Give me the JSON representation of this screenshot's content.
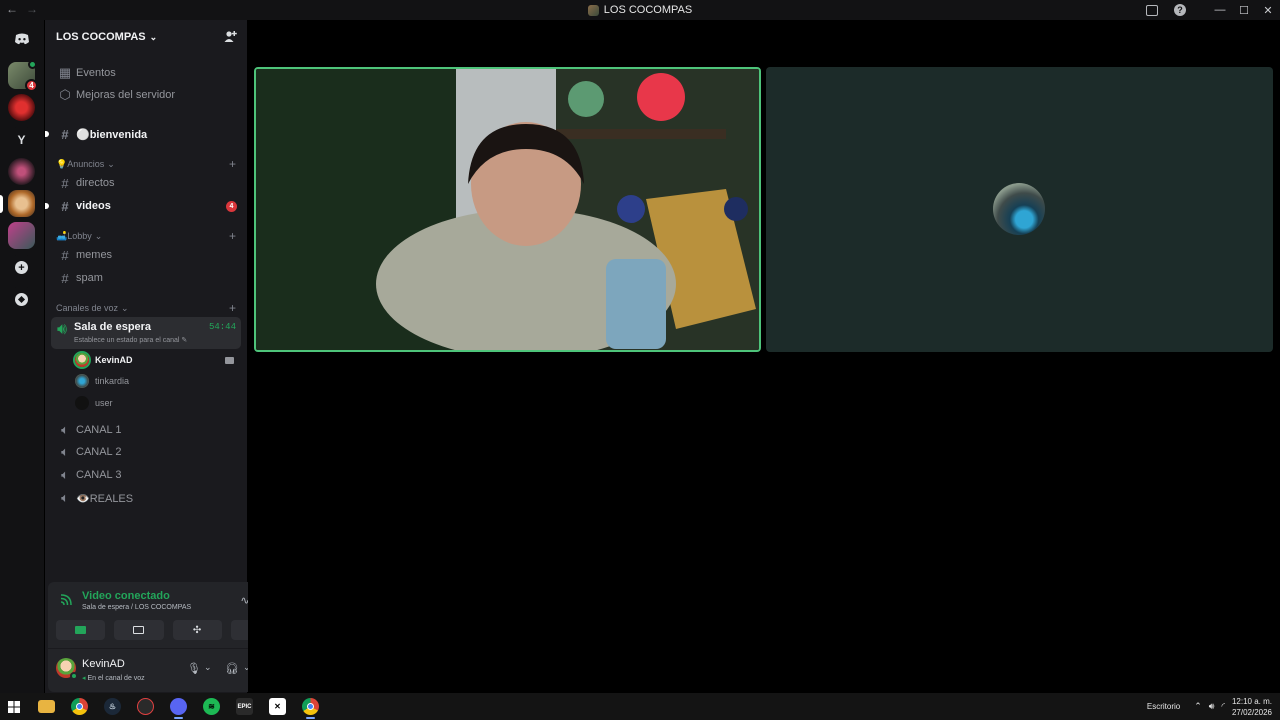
{
  "window": {
    "title": "LOS COCOMPAS"
  },
  "servers": {
    "badges": [
      "4"
    ],
    "letter_server": "Y"
  },
  "server": {
    "name": "LOS COCOMPAS",
    "menu": [
      {
        "label": "Eventos"
      },
      {
        "label": "Mejoras del servidor"
      }
    ],
    "channels": {
      "bienvenida": "⚪bienvenida",
      "cat_anuncios": "💡Anuncios",
      "directos": "directos",
      "videos": "videos",
      "videos_badge": "4",
      "cat_lobby": "🛋️Lobby",
      "memes": "memes",
      "spam": "spam",
      "cat_voz": "Canales de voz",
      "sala": "Sala de espera",
      "sala_time": "54:44",
      "sala_status": "Establece un estado para el canal",
      "canal1": "CANAL 1",
      "canal2": "CANAL 2",
      "canal3": "CANAL 3",
      "reales": "👁️REALES"
    },
    "voice_users": [
      {
        "name": "KevinAD"
      },
      {
        "name": "tinkardia"
      },
      {
        "name": "user"
      }
    ]
  },
  "voice_panel": {
    "status": "Video conectado",
    "location": "Sala de espera / LOS COCOMPAS"
  },
  "user": {
    "name": "KevinAD",
    "status": "En el canal de voz"
  },
  "taskbar": {
    "desktop_label": "Escritorio",
    "time": "12:10 a. m.",
    "date": "27/02/2026",
    "epic_label": "EPIC"
  },
  "colors": {
    "speaking": "#4ec47a",
    "mention": "#da373c",
    "connected": "#23a55a"
  }
}
